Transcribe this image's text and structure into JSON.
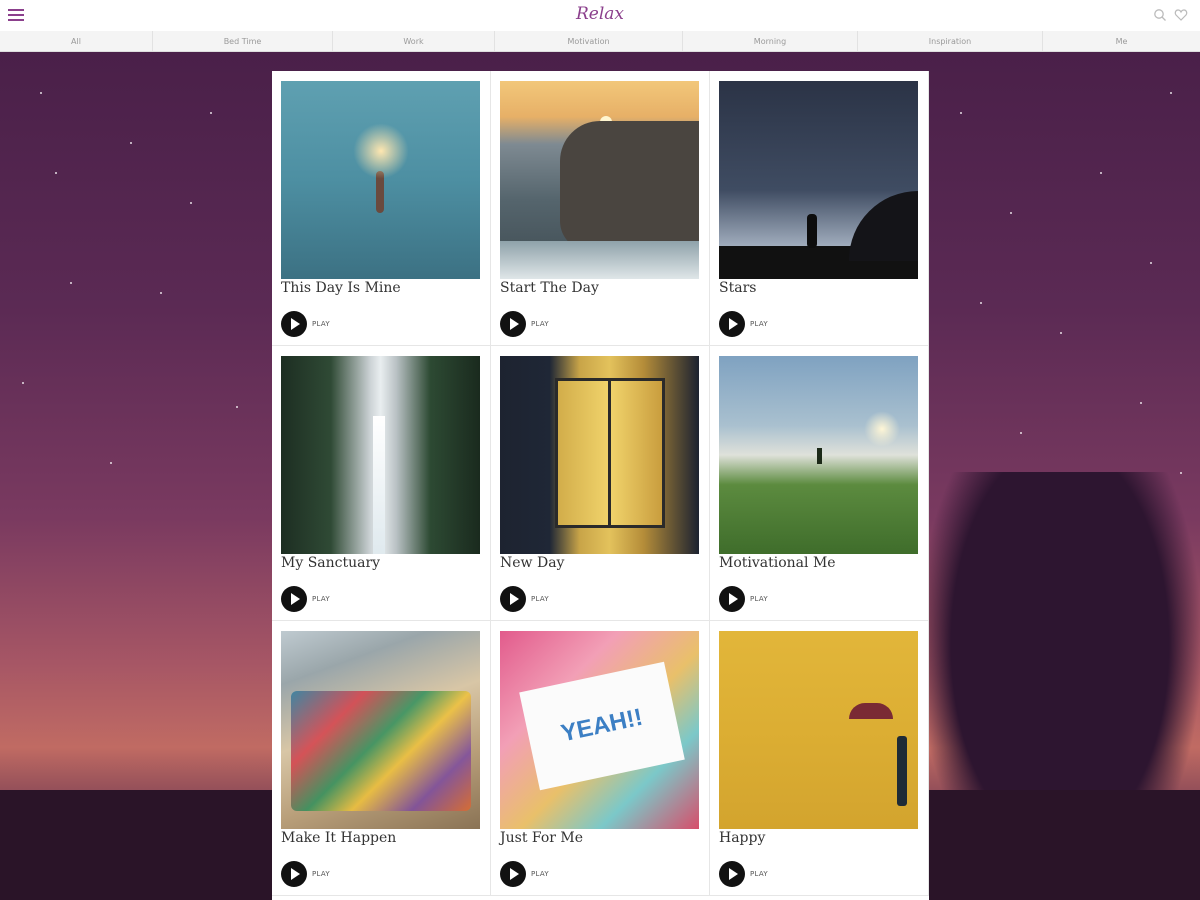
{
  "header": {
    "title": "Relax"
  },
  "tabs": [
    {
      "label": "All"
    },
    {
      "label": "Bed Time"
    },
    {
      "label": "Work"
    },
    {
      "label": "Motivation"
    },
    {
      "label": "Morning"
    },
    {
      "label": "Inspiration"
    },
    {
      "label": "Me"
    }
  ],
  "cards": [
    {
      "title": "This Day Is Mine",
      "play_label": "PLAY"
    },
    {
      "title": "Start The Day",
      "play_label": "PLAY"
    },
    {
      "title": "Stars",
      "play_label": "PLAY"
    },
    {
      "title": "My Sanctuary",
      "play_label": "PLAY"
    },
    {
      "title": "New Day",
      "play_label": "PLAY"
    },
    {
      "title": "Motivational Me",
      "play_label": "PLAY"
    },
    {
      "title": "Make It Happen",
      "play_label": "PLAY"
    },
    {
      "title": "Just For Me",
      "play_label": "PLAY"
    },
    {
      "title": "Happy",
      "play_label": "PLAY"
    }
  ],
  "icons": {
    "menu": "hamburger-menu-icon",
    "search": "search-icon",
    "favorites": "heart-icon",
    "play": "play-icon"
  },
  "colors": {
    "accent": "#8b3f8c",
    "panel_bg": "#ffffff",
    "play_button": "#111111"
  },
  "thumb_texts": {
    "card_8_sign": "YEAH!!"
  }
}
